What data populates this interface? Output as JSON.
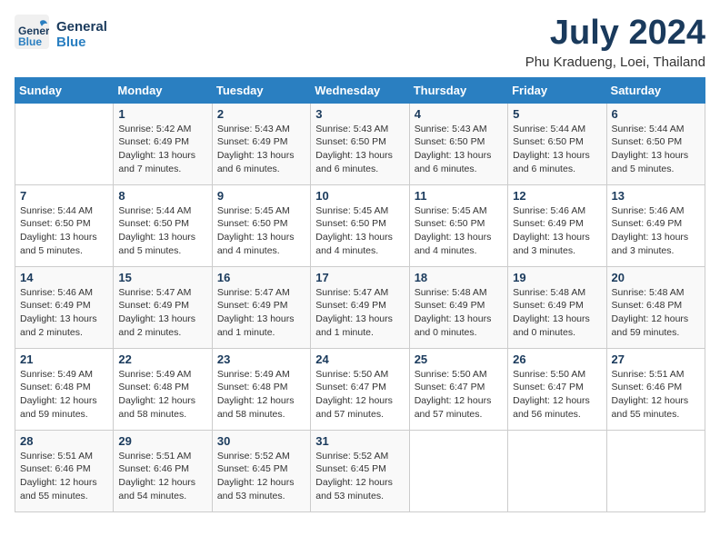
{
  "logo": {
    "line1": "General",
    "line2": "Blue"
  },
  "title": "July 2024",
  "location": "Phu Kradueng, Loei, Thailand",
  "days_of_week": [
    "Sunday",
    "Monday",
    "Tuesday",
    "Wednesday",
    "Thursday",
    "Friday",
    "Saturday"
  ],
  "weeks": [
    [
      {
        "day": "",
        "info": ""
      },
      {
        "day": "1",
        "info": "Sunrise: 5:42 AM\nSunset: 6:49 PM\nDaylight: 13 hours\nand 7 minutes."
      },
      {
        "day": "2",
        "info": "Sunrise: 5:43 AM\nSunset: 6:49 PM\nDaylight: 13 hours\nand 6 minutes."
      },
      {
        "day": "3",
        "info": "Sunrise: 5:43 AM\nSunset: 6:50 PM\nDaylight: 13 hours\nand 6 minutes."
      },
      {
        "day": "4",
        "info": "Sunrise: 5:43 AM\nSunset: 6:50 PM\nDaylight: 13 hours\nand 6 minutes."
      },
      {
        "day": "5",
        "info": "Sunrise: 5:44 AM\nSunset: 6:50 PM\nDaylight: 13 hours\nand 6 minutes."
      },
      {
        "day": "6",
        "info": "Sunrise: 5:44 AM\nSunset: 6:50 PM\nDaylight: 13 hours\nand 5 minutes."
      }
    ],
    [
      {
        "day": "7",
        "info": "Sunrise: 5:44 AM\nSunset: 6:50 PM\nDaylight: 13 hours\nand 5 minutes."
      },
      {
        "day": "8",
        "info": "Sunrise: 5:44 AM\nSunset: 6:50 PM\nDaylight: 13 hours\nand 5 minutes."
      },
      {
        "day": "9",
        "info": "Sunrise: 5:45 AM\nSunset: 6:50 PM\nDaylight: 13 hours\nand 4 minutes."
      },
      {
        "day": "10",
        "info": "Sunrise: 5:45 AM\nSunset: 6:50 PM\nDaylight: 13 hours\nand 4 minutes."
      },
      {
        "day": "11",
        "info": "Sunrise: 5:45 AM\nSunset: 6:50 PM\nDaylight: 13 hours\nand 4 minutes."
      },
      {
        "day": "12",
        "info": "Sunrise: 5:46 AM\nSunset: 6:49 PM\nDaylight: 13 hours\nand 3 minutes."
      },
      {
        "day": "13",
        "info": "Sunrise: 5:46 AM\nSunset: 6:49 PM\nDaylight: 13 hours\nand 3 minutes."
      }
    ],
    [
      {
        "day": "14",
        "info": "Sunrise: 5:46 AM\nSunset: 6:49 PM\nDaylight: 13 hours\nand 2 minutes."
      },
      {
        "day": "15",
        "info": "Sunrise: 5:47 AM\nSunset: 6:49 PM\nDaylight: 13 hours\nand 2 minutes."
      },
      {
        "day": "16",
        "info": "Sunrise: 5:47 AM\nSunset: 6:49 PM\nDaylight: 13 hours\nand 1 minute."
      },
      {
        "day": "17",
        "info": "Sunrise: 5:47 AM\nSunset: 6:49 PM\nDaylight: 13 hours\nand 1 minute."
      },
      {
        "day": "18",
        "info": "Sunrise: 5:48 AM\nSunset: 6:49 PM\nDaylight: 13 hours\nand 0 minutes."
      },
      {
        "day": "19",
        "info": "Sunrise: 5:48 AM\nSunset: 6:49 PM\nDaylight: 13 hours\nand 0 minutes."
      },
      {
        "day": "20",
        "info": "Sunrise: 5:48 AM\nSunset: 6:48 PM\nDaylight: 12 hours\nand 59 minutes."
      }
    ],
    [
      {
        "day": "21",
        "info": "Sunrise: 5:49 AM\nSunset: 6:48 PM\nDaylight: 12 hours\nand 59 minutes."
      },
      {
        "day": "22",
        "info": "Sunrise: 5:49 AM\nSunset: 6:48 PM\nDaylight: 12 hours\nand 58 minutes."
      },
      {
        "day": "23",
        "info": "Sunrise: 5:49 AM\nSunset: 6:48 PM\nDaylight: 12 hours\nand 58 minutes."
      },
      {
        "day": "24",
        "info": "Sunrise: 5:50 AM\nSunset: 6:47 PM\nDaylight: 12 hours\nand 57 minutes."
      },
      {
        "day": "25",
        "info": "Sunrise: 5:50 AM\nSunset: 6:47 PM\nDaylight: 12 hours\nand 57 minutes."
      },
      {
        "day": "26",
        "info": "Sunrise: 5:50 AM\nSunset: 6:47 PM\nDaylight: 12 hours\nand 56 minutes."
      },
      {
        "day": "27",
        "info": "Sunrise: 5:51 AM\nSunset: 6:46 PM\nDaylight: 12 hours\nand 55 minutes."
      }
    ],
    [
      {
        "day": "28",
        "info": "Sunrise: 5:51 AM\nSunset: 6:46 PM\nDaylight: 12 hours\nand 55 minutes."
      },
      {
        "day": "29",
        "info": "Sunrise: 5:51 AM\nSunset: 6:46 PM\nDaylight: 12 hours\nand 54 minutes."
      },
      {
        "day": "30",
        "info": "Sunrise: 5:52 AM\nSunset: 6:45 PM\nDaylight: 12 hours\nand 53 minutes."
      },
      {
        "day": "31",
        "info": "Sunrise: 5:52 AM\nSunset: 6:45 PM\nDaylight: 12 hours\nand 53 minutes."
      },
      {
        "day": "",
        "info": ""
      },
      {
        "day": "",
        "info": ""
      },
      {
        "day": "",
        "info": ""
      }
    ]
  ]
}
